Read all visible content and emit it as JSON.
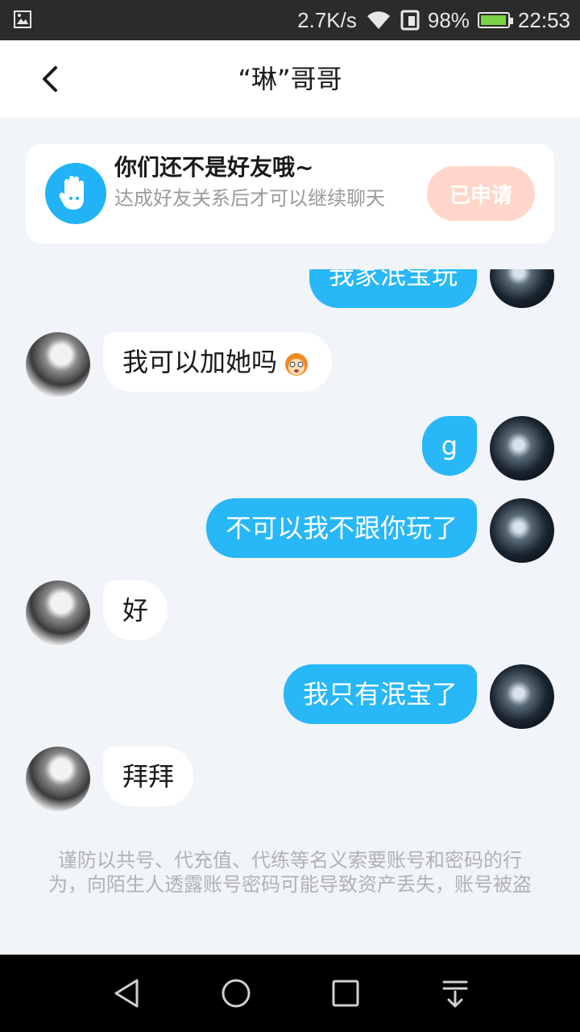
{
  "status_bar": {
    "speed": "2.7K/s",
    "battery_percent": "98%",
    "battery_level": 0.98,
    "time": "22:53"
  },
  "header": {
    "title": "“琳”哥哥"
  },
  "notice": {
    "title": "你们还不是好友哦~",
    "subtitle": "达成好友关系后才可以继续聊天",
    "button_label": "已申请"
  },
  "messages": [
    {
      "from": "me",
      "text": "我家泯宝玩"
    },
    {
      "from": "other",
      "text": "我可以加她吗"
    },
    {
      "from": "me",
      "text": "g"
    },
    {
      "from": "me",
      "text": "不可以我不跟你玩了"
    },
    {
      "from": "other",
      "text": "好"
    },
    {
      "from": "me",
      "text": "我只有泯宝了"
    },
    {
      "from": "other",
      "text": "拜拜"
    }
  ],
  "warning": "谨防以共号、代充值、代练等名义索要账号和密码的行为，向陌生人透露账号密码可能导致资产丢失，账号被盗",
  "colors": {
    "accent": "#28b7f7",
    "applied_button": "#ffd6c9"
  }
}
